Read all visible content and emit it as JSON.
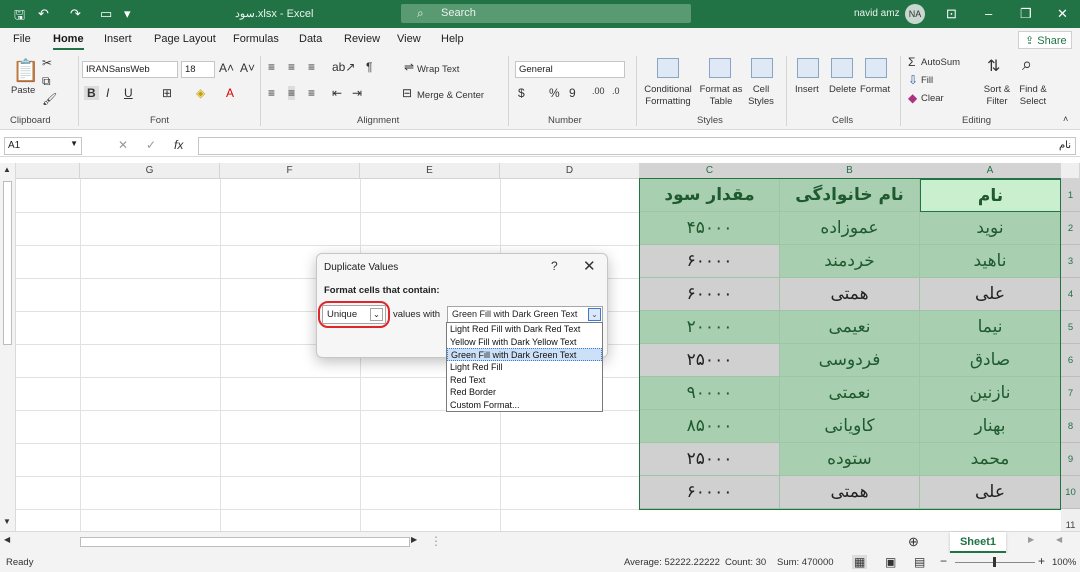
{
  "titlebar": {
    "title": "سود.xlsx - Excel",
    "search_placeholder": "Search",
    "user_name": "navid amz",
    "user_initials": "NA"
  },
  "menu": {
    "tabs": [
      "File",
      "Home",
      "Insert",
      "Page Layout",
      "Formulas",
      "Data",
      "Review",
      "View",
      "Help"
    ],
    "active_tab": "Home",
    "share_label": "Share"
  },
  "ribbon": {
    "paste_label": "Paste",
    "font_name": "IRANSansWeb",
    "font_size": "18",
    "wrap_text": "Wrap Text",
    "merge_center": "Merge & Center",
    "number_format": "General",
    "conditional_formatting": "Conditional Formatting",
    "format_as_table": "Format as Table",
    "cell_styles": "Cell Styles",
    "insert": "Insert",
    "delete": "Delete",
    "format": "Format",
    "autosum": "AutoSum",
    "fill": "Fill",
    "clear": "Clear",
    "sort_filter": "Sort & Filter",
    "find_select": "Find & Select",
    "groups": [
      "Clipboard",
      "Font",
      "Alignment",
      "Number",
      "Styles",
      "Cells",
      "Editing"
    ]
  },
  "formula_bar": {
    "name_box": "A1",
    "formula": "نام"
  },
  "columns": [
    "G",
    "F",
    "E",
    "D",
    "C",
    "B",
    "A"
  ],
  "rows": [
    "1",
    "2",
    "3",
    "4",
    "5",
    "6",
    "7",
    "8",
    "9",
    "10",
    "11"
  ],
  "table": {
    "headers": [
      "مقدار سود",
      "نام خانوادگی",
      "نام"
    ],
    "rows": [
      [
        "۴۵۰۰۰",
        "عموزاده",
        "نوید"
      ],
      [
        "۶۰۰۰۰",
        "خردمند",
        "ناهید"
      ],
      [
        "۶۰۰۰۰",
        "همتی",
        "علی"
      ],
      [
        "۲۰۰۰۰",
        "نعیمی",
        "نیما"
      ],
      [
        "۲۵۰۰۰",
        "فردوسی",
        "صادق"
      ],
      [
        "۹۰۰۰۰",
        "نعمتی",
        "نازنین"
      ],
      [
        "۸۵۰۰۰",
        "کاویانی",
        "بهنار"
      ],
      [
        "۲۵۰۰۰",
        "ستوده",
        "محمد"
      ],
      [
        "۶۰۰۰۰",
        "همتی",
        "علی"
      ]
    ],
    "colors": {
      "green": "#a8cfb0",
      "gray": "#d0d0d0",
      "light_green": "#c9efce"
    }
  },
  "dialog": {
    "title": "Duplicate Values",
    "help": "?",
    "label": "Format cells that contain:",
    "type_value": "Unique",
    "values_with": "values with",
    "format_value": "Green Fill with Dark Green Text",
    "options": [
      "Light Red Fill with Dark Red Text",
      "Yellow Fill with Dark Yellow Text",
      "Green Fill with Dark Green Text",
      "Light Red Fill",
      "Red Text",
      "Red Border",
      "Custom Format..."
    ]
  },
  "sheet": {
    "tab": "Sheet1"
  },
  "status": {
    "ready": "Ready",
    "average": "Average: 52222.22222",
    "count": "Count: 30",
    "sum": "Sum: 470000",
    "zoom": "100%"
  }
}
